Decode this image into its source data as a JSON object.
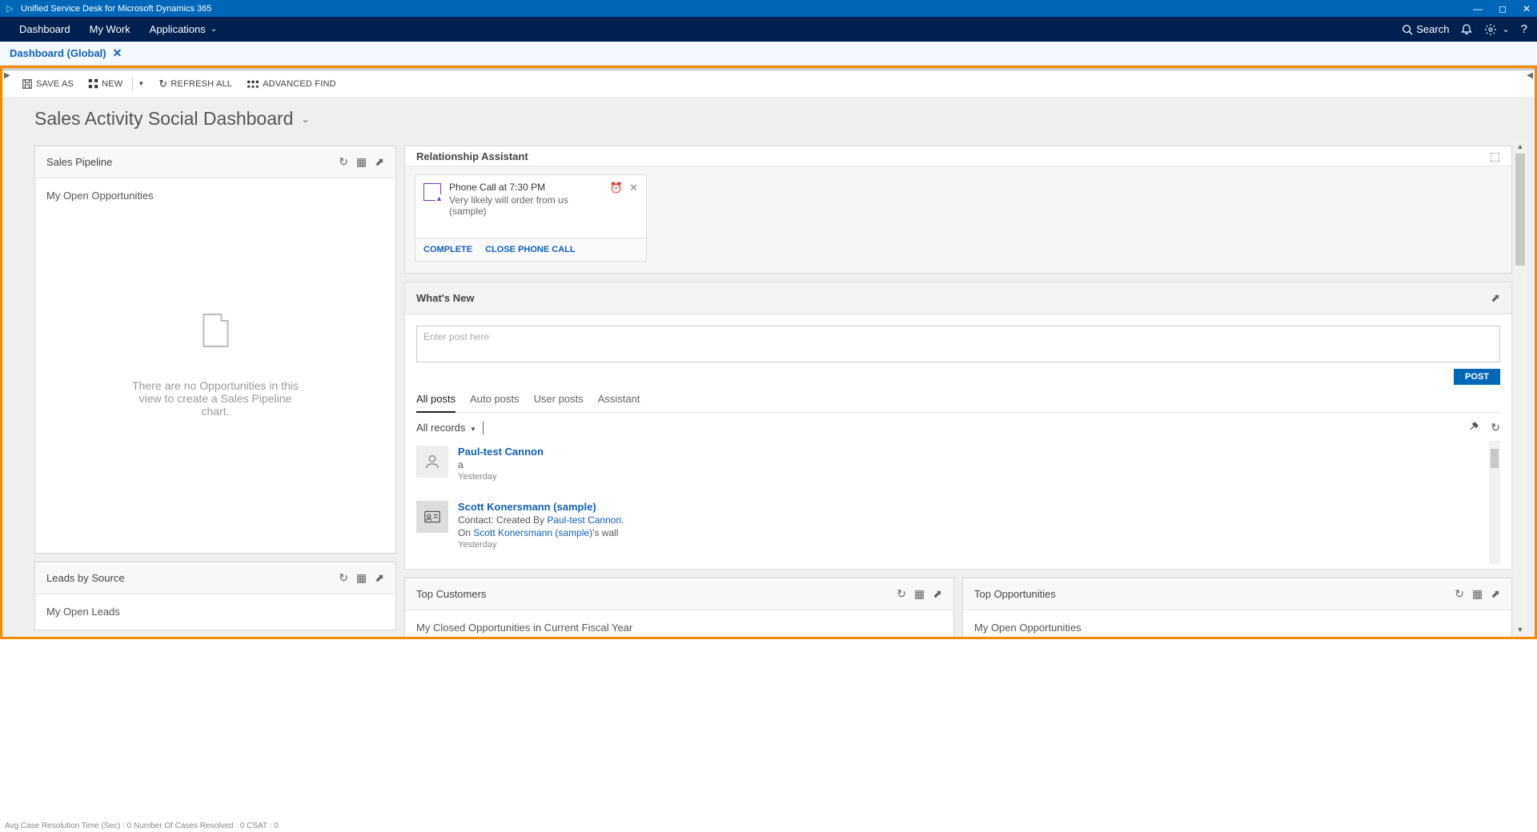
{
  "titlebar": {
    "title": "Unified Service Desk for Microsoft Dynamics 365"
  },
  "navbar": {
    "items": [
      "Dashboard",
      "My Work",
      "Applications"
    ],
    "search": "Search"
  },
  "tabstrip": {
    "tab": "Dashboard (Global)"
  },
  "toolbar": {
    "save_as": "SAVE AS",
    "new": "NEW",
    "refresh_all": "REFRESH ALL",
    "advanced_find": "ADVANCED FIND"
  },
  "dashboard": {
    "title": "Sales Activity Social Dashboard"
  },
  "panels": {
    "pipeline": {
      "title": "Sales Pipeline",
      "subtitle": "My Open Opportunities",
      "empty": "There are no Opportunities in this view to create a Sales Pipeline chart."
    },
    "ra": {
      "title": "Relationship Assistant",
      "card": {
        "line1": "Phone Call at 7:30 PM",
        "line2": "Very likely will order from us (sample)",
        "action_complete": "COMPLETE",
        "action_close": "CLOSE PHONE CALL"
      }
    },
    "wn": {
      "title": "What's New",
      "placeholder": "Enter post here",
      "post_btn": "POST",
      "tabs": [
        "All posts",
        "Auto posts",
        "User posts",
        "Assistant"
      ],
      "filter": "All records",
      "feed": [
        {
          "name": "Paul-test Cannon",
          "body": "a",
          "time": "Yesterday",
          "type": "user"
        },
        {
          "name": "Scott Konersmann (sample)",
          "prefix": "Contact: Created By ",
          "link1": "Paul-test Cannon",
          "suffix1": ".",
          "line2a": "On ",
          "link2": "Scott Konersmann (sample)",
          "line2b": "'s wall",
          "time": "Yesterday",
          "type": "contact"
        }
      ]
    },
    "leads": {
      "title": "Leads by Source",
      "subtitle": "My Open Leads"
    },
    "topcust": {
      "title": "Top Customers",
      "subtitle": "My Closed Opportunities in Current Fiscal Year"
    },
    "topopp": {
      "title": "Top Opportunities",
      "subtitle": "My Open Opportunities"
    }
  },
  "statusbar": "Avg Case Resolution Time (Sec) :   0   Number Of Cases Resolved :   0   CSAT :   0"
}
